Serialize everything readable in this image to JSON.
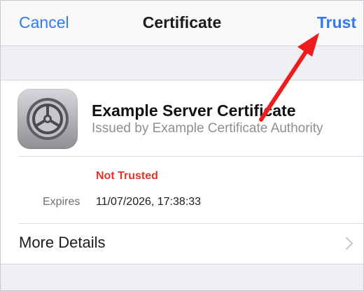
{
  "nav": {
    "cancel_label": "Cancel",
    "title": "Certificate",
    "trust_label": "Trust"
  },
  "certificate": {
    "icon": "settings-gear-icon",
    "name": "Example Server Certificate",
    "issuer": "Issued by Example Certificate Authority",
    "status": "Not Trusted",
    "expires_label": "Expires",
    "expires_value": "11/07/2026, 17:38:33"
  },
  "details": {
    "label": "More Details",
    "chevron_icon": "chevron-right-icon"
  },
  "colors": {
    "accent": "#2f7bf4",
    "warning": "#e0352b",
    "annotation_arrow": "#ee1c1c"
  }
}
